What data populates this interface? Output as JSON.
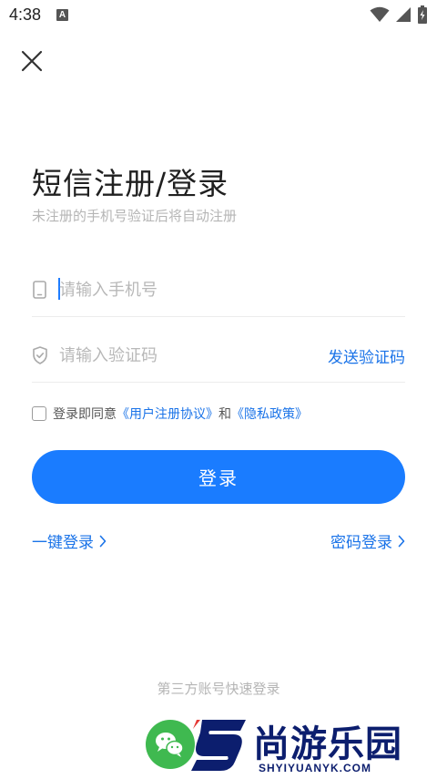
{
  "status_bar": {
    "time": "4:38",
    "notification_badge": "A"
  },
  "header": {
    "close_icon": "close-icon"
  },
  "main": {
    "title": "短信注册/登录",
    "subtitle": "未注册的手机号验证后将自动注册",
    "phone_field": {
      "placeholder": "请输入手机号",
      "value": ""
    },
    "code_field": {
      "placeholder": "请输入验证码",
      "value": "",
      "send_code_label": "发送验证码"
    },
    "agreement": {
      "prefix": "登录即同意",
      "user_agreement": "《用户注册协议》",
      "conjunction": "和",
      "privacy_policy": "《隐私政策》",
      "checked": false
    },
    "login_button": "登录",
    "one_click_login": "一键登录",
    "password_login": "密码登录"
  },
  "third_party": {
    "title": "第三方账号快速登录"
  },
  "watermark": {
    "name": "尚游乐园",
    "domain": "SHYIYUANYK.COM"
  },
  "colors": {
    "accent": "#1a7cff",
    "link": "#1a73e8",
    "placeholder": "#b8b8b8",
    "wechat": "#3fb950",
    "watermark": "#0c1e6e"
  }
}
